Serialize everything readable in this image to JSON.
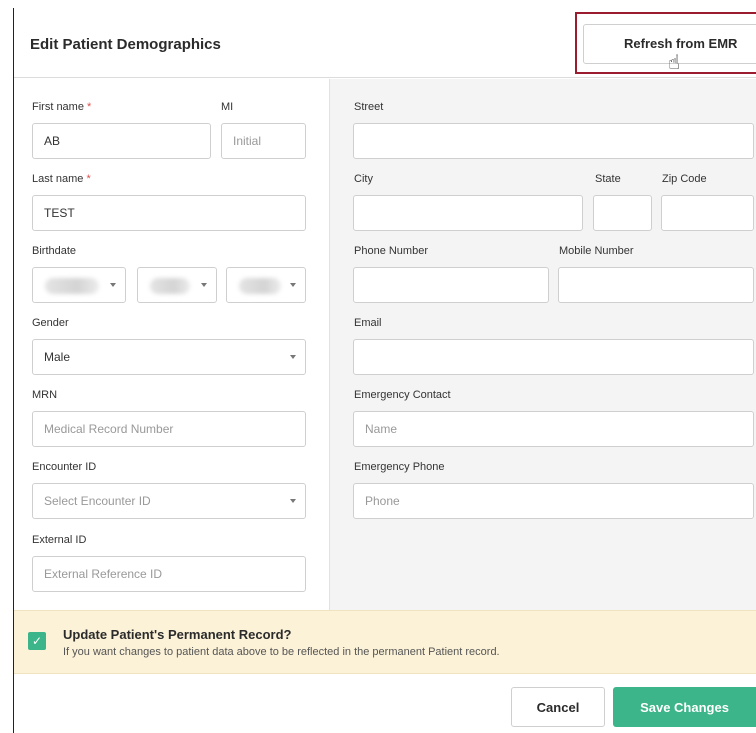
{
  "modal": {
    "title": "Edit Patient Demographics",
    "refresh_button": "Refresh from EMR"
  },
  "left": {
    "first_name": {
      "label": "First name",
      "required": "*",
      "value": "AB"
    },
    "mi": {
      "label": "MI",
      "placeholder": "Initial"
    },
    "last_name": {
      "label": "Last name",
      "required": "*",
      "value": "TEST"
    },
    "birthdate": {
      "label": "Birthdate"
    },
    "gender": {
      "label": "Gender",
      "value": "Male"
    },
    "mrn": {
      "label": "MRN",
      "placeholder": "Medical Record Number"
    },
    "encounter_id": {
      "label": "Encounter ID",
      "placeholder": "Select Encounter ID"
    },
    "external_id": {
      "label": "External ID",
      "placeholder": "External Reference ID"
    }
  },
  "right": {
    "street": {
      "label": "Street"
    },
    "city": {
      "label": "City"
    },
    "state": {
      "label": "State"
    },
    "zip": {
      "label": "Zip Code"
    },
    "phone": {
      "label": "Phone Number"
    },
    "mobile": {
      "label": "Mobile Number"
    },
    "email": {
      "label": "Email"
    },
    "emergency_contact": {
      "label": "Emergency Contact",
      "placeholder": "Name"
    },
    "emergency_phone": {
      "label": "Emergency Phone",
      "placeholder": "Phone"
    }
  },
  "update": {
    "checked": true,
    "checkmark": "✓",
    "title": "Update Patient's Permanent Record?",
    "description": "If you want changes to patient data above to be reflected in the permanent Patient record."
  },
  "footer": {
    "cancel": "Cancel",
    "save": "Save Changes"
  },
  "icons": {
    "cursor": "☝"
  },
  "colors": {
    "accent": "#3bb589",
    "highlight_border": "#9b1c2e",
    "required": "#d9534f",
    "banner": "#fcf2d8"
  }
}
